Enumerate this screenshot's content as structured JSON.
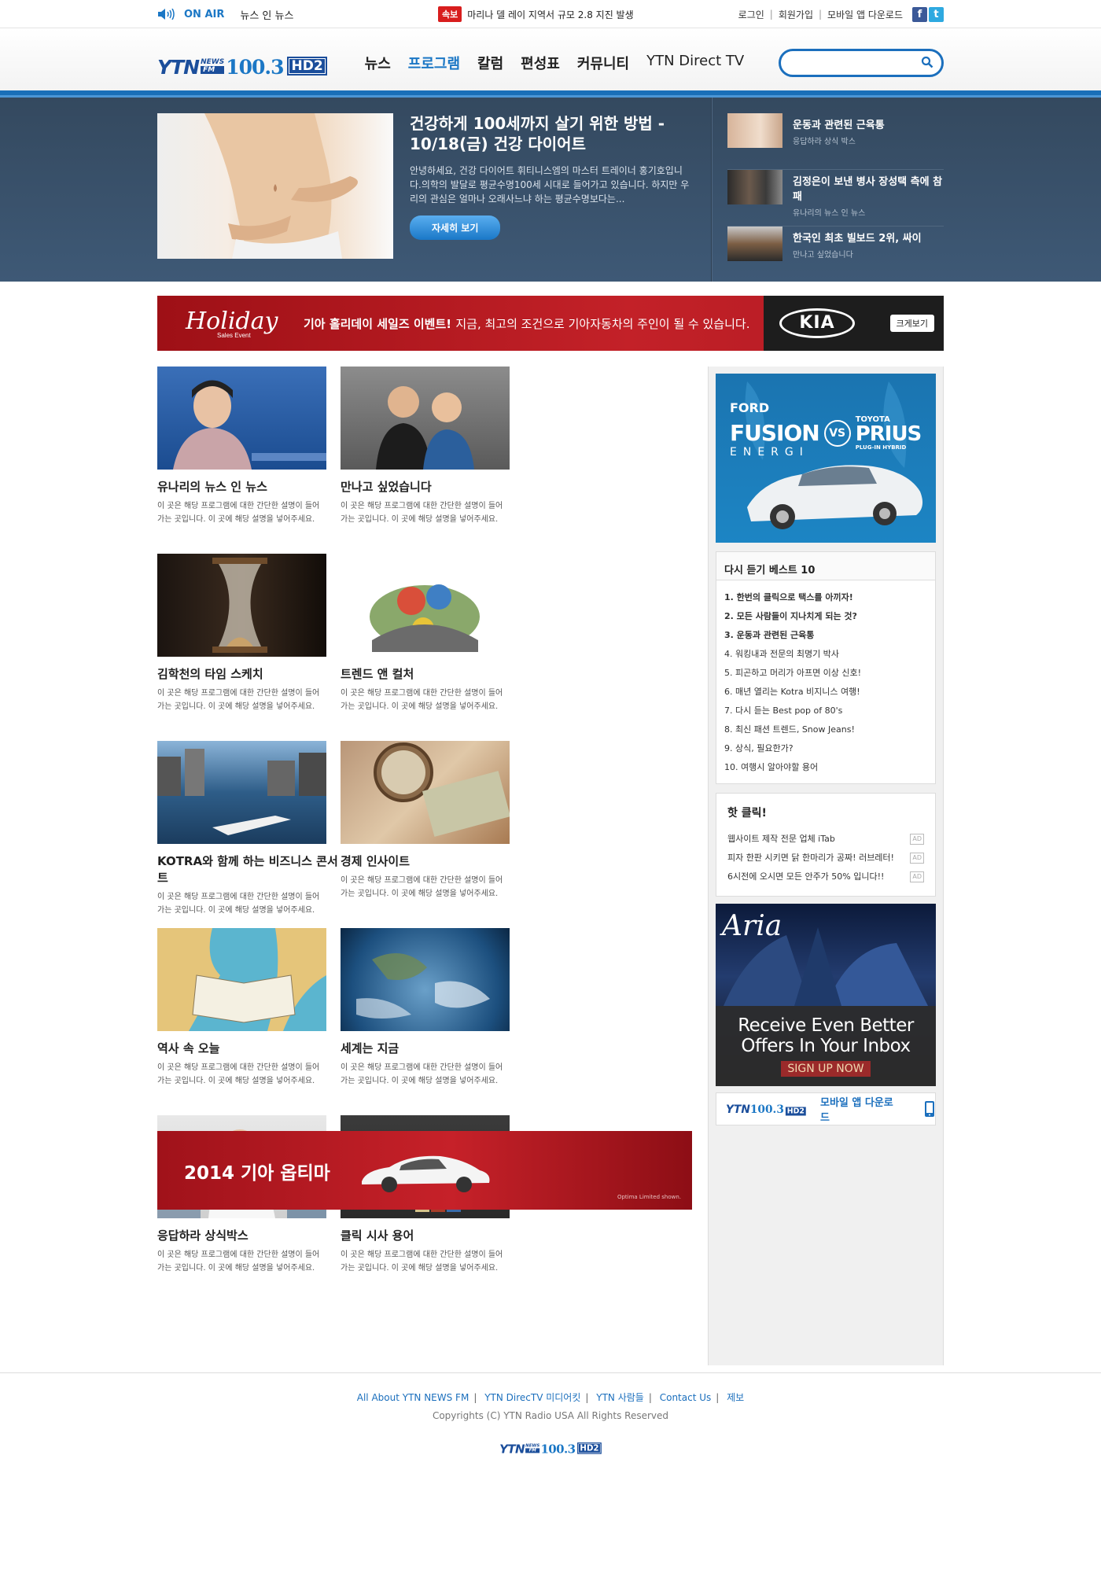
{
  "topbar": {
    "onair_label": "ON AIR",
    "onair_program": "뉴스 인 뉴스",
    "breaking_tag": "속보",
    "breaking_text": "마리나 델 레이 지역서 규모 2.8 지진 발생",
    "login": "로그인",
    "join": "회원가입",
    "app_download": "모바일 앱 다운로드",
    "facebook": "f",
    "twitter": "t"
  },
  "logo": {
    "ytn": "YTN",
    "news": "NEWS",
    "fm": "FM",
    "freq": "100.3",
    "hd": "HD2"
  },
  "nav": [
    "뉴스",
    "프로그램",
    "칼럼",
    "편성표",
    "커뮤니티",
    "YTN Direct TV"
  ],
  "hero": {
    "title": "건강하게 100세까지 살기 위한 방법 - 10/18(금) 건강 다이어트",
    "desc": "안녕하세요, 건강 다이어트 휘티니스엠의 마스터 트레이너 홍기호입니다.의학의 발달로 평균수명100세 시대로 들어가고 있습니다. 하지만 우리의 관심은 얼마나 오래사느냐 하는 평균수명보다는...",
    "button": "자세히 보기",
    "side": [
      {
        "title": "운동과 관련된 근육통",
        "sub": "응답하라 상식 박스"
      },
      {
        "title": "김정은이 보낸 병사 장성택 측에 참패",
        "sub": "유나리의 뉴스 인 뉴스"
      },
      {
        "title": "한국인 최초 빌보드 2위, 싸이",
        "sub": "만나고 싶었습니다"
      }
    ]
  },
  "kia_banner": {
    "holiday": "Holiday",
    "sales_event": "Sales Event",
    "message_bold": "기아 홀리데이 세일즈 이벤트!",
    "message": "지금, 최고의 조건으로 기아자동차의 주인이 될 수 있습니다.",
    "brand": "KIA",
    "more": "크게보기"
  },
  "programs": [
    {
      "title": "유나리의 뉴스 인 뉴스",
      "desc": "이 곳은 해당 프로그램에 대한 간단한 설명이 들어가는 곳입니다. 이 곳에 해당 설명을 넣어주세요."
    },
    {
      "title": "만나고 싶었습니다",
      "desc": "이 곳은 해당 프로그램에 대한 간단한 설명이 들어가는 곳입니다. 이 곳에 해당 설명을 넣어주세요."
    },
    {
      "title": "김학천의 타임 스케치",
      "desc": "이 곳은 해당 프로그램에 대한 간단한 설명이 들어가는 곳입니다. 이 곳에 해당 설명을 넣어주세요."
    },
    {
      "title": "트렌드 앤 컬처",
      "desc": "이 곳은 해당 프로그램에 대한 간단한 설명이 들어가는 곳입니다. 이 곳에 해당 설명을 넣어주세요."
    },
    {
      "title": "KOTRA와 함께 하는 비즈니스 콘서트",
      "desc": "이 곳은 해당 프로그램에 대한 간단한 설명이 들어가는 곳입니다. 이 곳에 해당 설명을 넣어주세요."
    },
    {
      "title": "경제 인사이트",
      "desc": "이 곳은 해당 프로그램에 대한 간단한 설명이 들어가는 곳입니다. 이 곳에 해당 설명을 넣어주세요."
    },
    {
      "title": "역사 속 오늘",
      "desc": "이 곳은 해당 프로그램에 대한 간단한 설명이 들어가는 곳입니다. 이 곳에 해당 설명을 넣어주세요."
    },
    {
      "title": "세계는 지금",
      "desc": "이 곳은 해당 프로그램에 대한 간단한 설명이 들어가는 곳입니다. 이 곳에 해당 설명을 넣어주세요."
    },
    {
      "title": "응답하라 상식박스",
      "desc": "이 곳은 해당 프로그램에 대한 간단한 설명이 들어가는 곳입니다. 이 곳에 해당 설명을 넣어주세요."
    },
    {
      "title": "클릭 시사 용어",
      "desc": "이 곳은 해당 프로그램에 대한 간단한 설명이 들어가는 곳입니다. 이 곳에 해당 설명을 넣어주세요."
    }
  ],
  "optima_banner": {
    "title": "2014 기아 옵티마",
    "note": "Optima Limited shown."
  },
  "sidebar": {
    "ford_ad": {
      "ford": "FORD",
      "fusion": "FUSION",
      "energi": "ENERGI",
      "vs": "VS",
      "toyota": "TOYOTA",
      "prius": "PRIUS",
      "plugin": "PLUG-IN HYBRID"
    },
    "best_title": "다시 듣기 베스트 10",
    "best": [
      "1. 한번의 클릭으로 택스를 아끼자!",
      "2. 모든 사람들이 지나치게 되는 것?",
      "3. 운동과 관련된 근육통",
      "4. 워킹내과 전문의 최명기 박사",
      "5. 피곤하고 머리가 아프면 이상 신호!",
      "6. 매년 열리는 Kotra 비지니스 여행!",
      "7. 다시 듣는 Best pop of 80's",
      "8. 최신 패션 트렌드, Snow Jeans!",
      "9. 상식, 필요한가?",
      "10. 여행시 알아야할 용어"
    ],
    "hot_title": "핫 클릭!",
    "hot": [
      "웹사이트 제작 전문 업체 iTab",
      "피자 한판 시키면 닭 한마리가 공짜! 러브레터!",
      "6시전에 오시면 모든 안주가 50% 입니다!!"
    ],
    "ad_tag": "AD",
    "aria_ad": {
      "logo": "Aria",
      "line1": "Receive Even Better",
      "line2": "Offers In Your Inbox",
      "signup": "SIGN UP NOW"
    },
    "mobile_label": "모바일 앱 다운로드"
  },
  "footer": {
    "links": [
      "All About YTN NEWS FM",
      "YTN DirecTV 미디어킷",
      "YTN 사람들",
      "Contact Us",
      "제보"
    ],
    "copyright": "Copyrights (C) YTN Radio USA All Rights Reserved"
  },
  "colors": {
    "accent": "#1b77c5",
    "nav_active": "#1b77c5",
    "hero_bg": "#3a526c",
    "ad_red": "#c32128"
  }
}
